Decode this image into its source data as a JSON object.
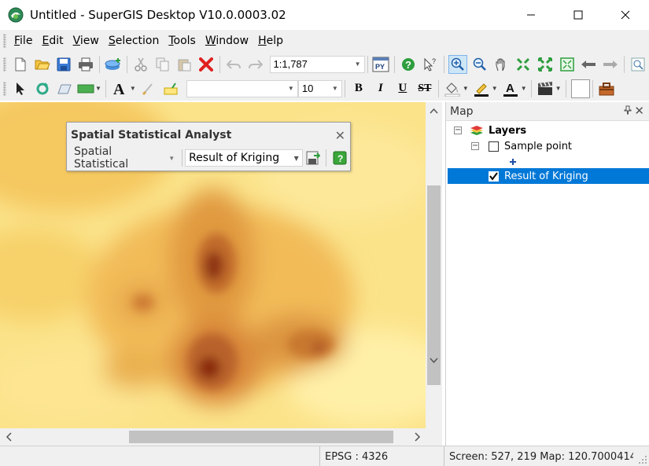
{
  "window": {
    "title": "Untitled - SuperGIS Desktop V10.0.0003.02"
  },
  "menu": {
    "items": [
      "File",
      "Edit",
      "View",
      "Selection",
      "Tools",
      "Window",
      "Help"
    ]
  },
  "toolbar1": {
    "scale_value": "1:1,787",
    "icons": [
      "new-icon",
      "open-icon",
      "save-icon",
      "print-icon",
      "add-layer-icon",
      "cut-icon",
      "copy-icon",
      "paste-icon",
      "delete-icon",
      "undo-icon",
      "redo-icon",
      "python-icon",
      "help-icon",
      "whats-this-icon",
      "zoom-in-icon",
      "zoom-out-icon",
      "pan-icon",
      "fixed-zoom-in-icon",
      "fixed-zoom-out-icon",
      "full-extent-icon",
      "back-icon",
      "forward-icon",
      "magnifier-icon"
    ]
  },
  "toolbar2": {
    "font_size_value": "10",
    "bold_label": "B",
    "italic_label": "I",
    "underline_label": "U",
    "strike_label": "ST"
  },
  "spatial_panel": {
    "title": "Spatial Statistical Analyst",
    "dropdown_label": "Spatial Statistical",
    "layer_value": "Result of Kriging"
  },
  "map_panel": {
    "title": "Map",
    "tree": {
      "root_label": "Layers",
      "layers": [
        {
          "label": "Sample point",
          "checked": false,
          "selected": false
        },
        {
          "label": "Result of Kriging",
          "checked": true,
          "selected": true
        }
      ]
    }
  },
  "statusbar": {
    "epsg": "EPSG : 4326",
    "coords": "Screen: 527, 219  Map: 120.7000414"
  },
  "colors": {
    "selection": "#0078d7",
    "map_light": "#fff0a0",
    "map_dark": "#8a2c10"
  }
}
